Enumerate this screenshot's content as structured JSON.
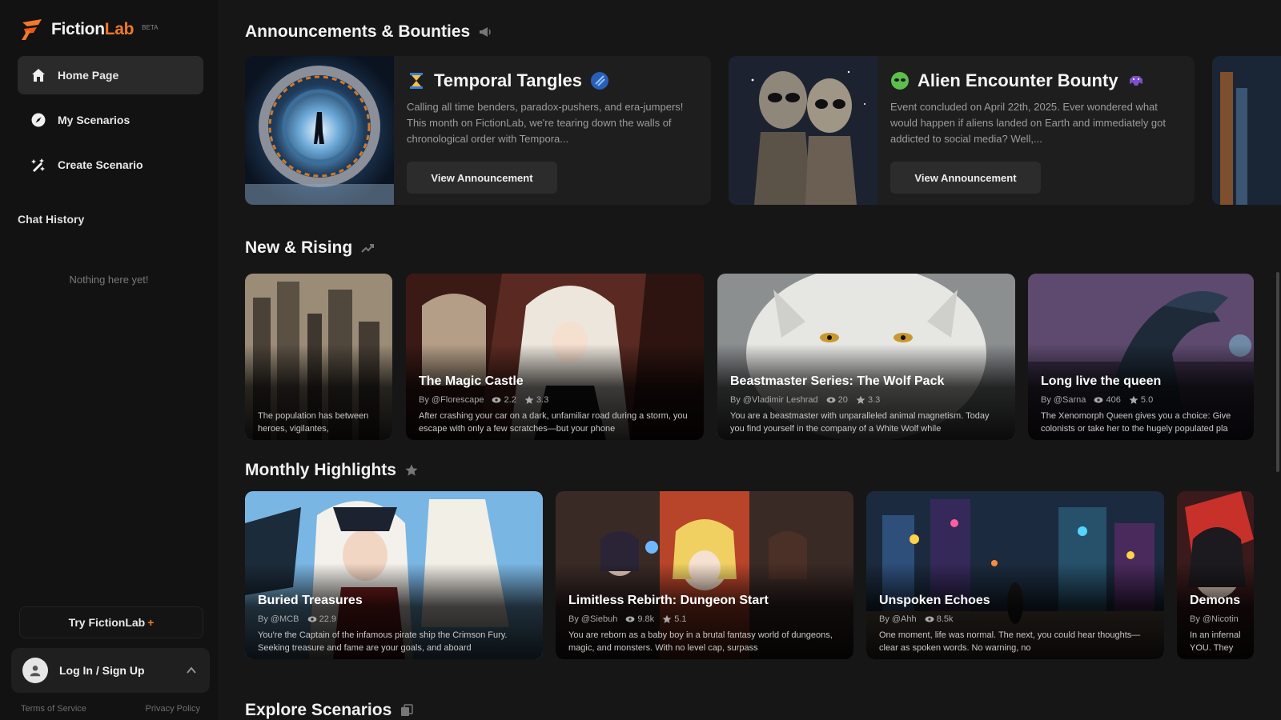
{
  "brand": {
    "name_part1": "Fiction",
    "name_part2": "Lab",
    "badge": "BETA"
  },
  "sidebar": {
    "nav": [
      {
        "label": "Home Page",
        "icon": "home-icon",
        "active": true
      },
      {
        "label": "My Scenarios",
        "icon": "compass-icon",
        "active": false
      },
      {
        "label": "Create Scenario",
        "icon": "create-icon",
        "active": false
      }
    ],
    "chat_history_label": "Chat History",
    "empty_text": "Nothing here yet!",
    "try_label": "Try FictionLab",
    "try_plus": "+",
    "login_label": "Log In / Sign Up",
    "terms": "Terms of Service",
    "privacy": "Privacy Policy"
  },
  "sections": {
    "announcements": "Announcements & Bounties",
    "new_rising": "New & Rising",
    "monthly": "Monthly Highlights",
    "explore": "Explore Scenarios"
  },
  "announcements": [
    {
      "title": "Temporal Tangles",
      "description": "Calling all time benders, paradox-pushers, and era-jumpers! This month on FictionLab, we're tearing down the walls of chronological order with Tempora...",
      "button": "View Announcement"
    },
    {
      "title": "Alien Encounter Bounty",
      "description": "Event concluded on April 22th, 2025. Ever wondered what would happen if aliens landed on Earth and immediately got addicted to social media? Well,...",
      "button": "View Announcement"
    }
  ],
  "new_rising": [
    {
      "title": "",
      "author": "",
      "views": "",
      "rating": "",
      "description": "The population has between heroes, vigilantes,"
    },
    {
      "title": "The Magic Castle",
      "author": "By @Florescape",
      "views": "2.2",
      "rating": "3.3",
      "description": "After crashing your car on a dark, unfamiliar road during a storm, you escape with only a few scratches—but your phone"
    },
    {
      "title": "Beastmaster Series: The Wolf Pack",
      "author": "By @Vladimir Leshrad",
      "views": "20",
      "rating": "3.3",
      "description": "You are a beastmaster with unparalleled animal magnetism. Today you find yourself in the company of a White Wolf while"
    },
    {
      "title": "Long live the queen",
      "author": "By @Sarna",
      "views": "406",
      "rating": "5.0",
      "description": "The Xenomorph Queen gives you a choice: Give colonists or take her to the hugely populated pla"
    }
  ],
  "monthly": [
    {
      "title": "Buried Treasures",
      "author": "By @MCB",
      "views": "22.9",
      "rating": "",
      "description": "You're the Captain of the infamous pirate ship the Crimson Fury. Seeking treasure and fame are your goals, and aboard"
    },
    {
      "title": "Limitless Rebirth: Dungeon Start",
      "author": "By @Siebuh",
      "views": "9.8k",
      "rating": "5.1",
      "description": "You are reborn as a baby boy in a brutal fantasy world of dungeons, magic, and monsters. With no level cap, surpass"
    },
    {
      "title": "Unspoken Echoes",
      "author": "By @Ahh",
      "views": "8.5k",
      "rating": "",
      "description": "One moment, life was normal. The next, you could hear thoughts—clear as spoken words. No warning, no"
    },
    {
      "title": "Demons",
      "author": "By @Nicotin",
      "views": "",
      "rating": "",
      "description": "In an infernal YOU. They are"
    }
  ],
  "colors": {
    "accent": "#f07a2a",
    "bg": "#161616",
    "sidebar": "#121212",
    "card": "#1e1e1e"
  }
}
